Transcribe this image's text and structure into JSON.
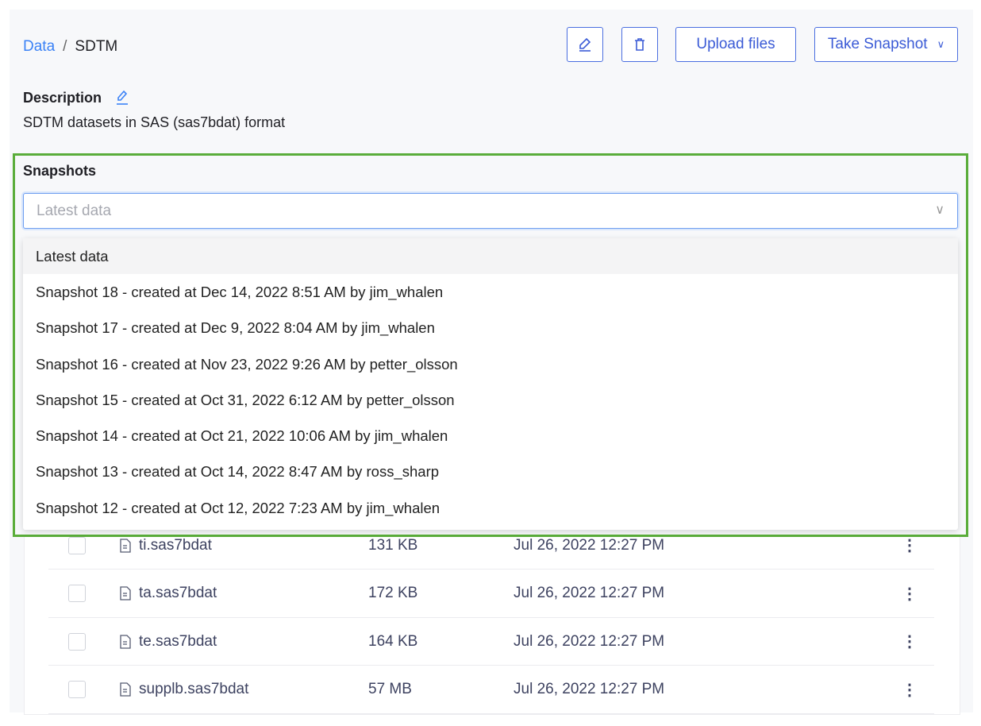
{
  "breadcrumb": {
    "parent": "Data",
    "separator": "/",
    "current": "SDTM"
  },
  "toolbar": {
    "edit_icon": "pencil-icon",
    "delete_icon": "trash-icon",
    "upload_label": "Upload files",
    "snapshot_label": "Take Snapshot"
  },
  "description": {
    "label": "Description",
    "text": "SDTM datasets in SAS (sas7bdat) format"
  },
  "snapshots": {
    "label": "Snapshots",
    "placeholder": "Latest data",
    "options": [
      "Latest data",
      "Snapshot 18 - created at Dec 14, 2022 8:51 AM by jim_whalen",
      "Snapshot 17 - created at Dec 9, 2022 8:04 AM by jim_whalen",
      "Snapshot 16 - created at Nov 23, 2022 9:26 AM by petter_olsson",
      "Snapshot 15 - created at Oct 31, 2022 6:12 AM by petter_olsson",
      "Snapshot 14 - created at Oct 21, 2022 10:06 AM by jim_whalen",
      "Snapshot 13 - created at Oct 14, 2022 8:47 AM by ross_sharp",
      "Snapshot 12 - created at Oct 12, 2022 7:23 AM by jim_whalen"
    ]
  },
  "files": [
    {
      "name": "ti.sas7bdat",
      "size": "131 KB",
      "modified": "Jul 26, 2022 12:27 PM"
    },
    {
      "name": "ta.sas7bdat",
      "size": "172 KB",
      "modified": "Jul 26, 2022 12:27 PM"
    },
    {
      "name": "te.sas7bdat",
      "size": "164 KB",
      "modified": "Jul 26, 2022 12:27 PM"
    },
    {
      "name": "supplb.sas7bdat",
      "size": "57 MB",
      "modified": "Jul 26, 2022 12:27 PM"
    }
  ],
  "colors": {
    "accent": "#3b5bd6",
    "highlight": "#5aad3a"
  }
}
